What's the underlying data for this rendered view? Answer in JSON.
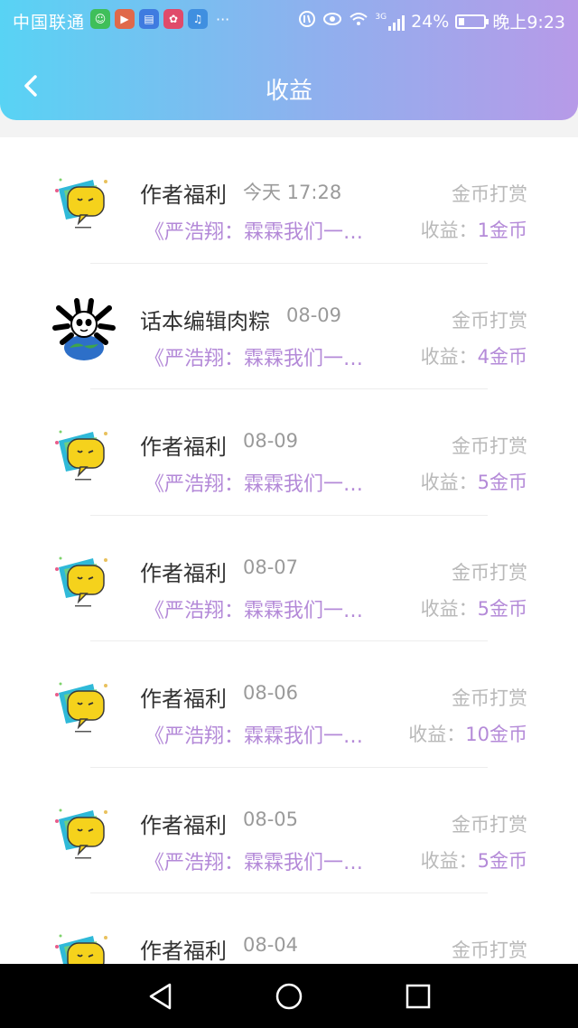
{
  "status": {
    "carrier": "中国联通",
    "signal": "3G",
    "battery": "24%",
    "battery_level": 0.24,
    "time": "晚上9:23",
    "more": "···"
  },
  "header": {
    "title": "收益",
    "back_icon": "chevron-left-icon"
  },
  "items": [
    {
      "name": "作者福利",
      "date": "今天 17:28",
      "type": "金币打赏",
      "work": "《严浩翔：霖霖我们一…",
      "earn_label": "收益：",
      "earn_value": "1金币",
      "avatar": "yellow-chat-bubble"
    },
    {
      "name": "话本编辑肉粽",
      "date": "08-09",
      "type": "金币打赏",
      "work": "《严浩翔：霖霖我们一…",
      "earn_label": "收益：",
      "earn_value": "4金币",
      "avatar": "panda-earth"
    },
    {
      "name": "作者福利",
      "date": "08-09",
      "type": "金币打赏",
      "work": "《严浩翔：霖霖我们一…",
      "earn_label": "收益：",
      "earn_value": "5金币",
      "avatar": "yellow-chat-bubble"
    },
    {
      "name": "作者福利",
      "date": "08-07",
      "type": "金币打赏",
      "work": "《严浩翔：霖霖我们一…",
      "earn_label": "收益：",
      "earn_value": "5金币",
      "avatar": "yellow-chat-bubble"
    },
    {
      "name": "作者福利",
      "date": "08-06",
      "type": "金币打赏",
      "work": "《严浩翔：霖霖我们一…",
      "earn_label": "收益：",
      "earn_value": "10金币",
      "avatar": "yellow-chat-bubble"
    },
    {
      "name": "作者福利",
      "date": "08-05",
      "type": "金币打赏",
      "work": "《严浩翔：霖霖我们一…",
      "earn_label": "收益：",
      "earn_value": "5金币",
      "avatar": "yellow-chat-bubble"
    },
    {
      "name": "作者福利",
      "date": "08-04",
      "type": "金币打赏",
      "work": "",
      "earn_label": "",
      "earn_value": "",
      "avatar": "yellow-chat-bubble"
    }
  ],
  "colors": {
    "accent": "#b48ad8",
    "muted": "#b9b9b9",
    "header_start": "#58d3f4",
    "header_end": "#b79ae8"
  },
  "nav": {
    "back": "triangle-back-icon",
    "home": "circle-home-icon",
    "recent": "square-recent-icon"
  }
}
